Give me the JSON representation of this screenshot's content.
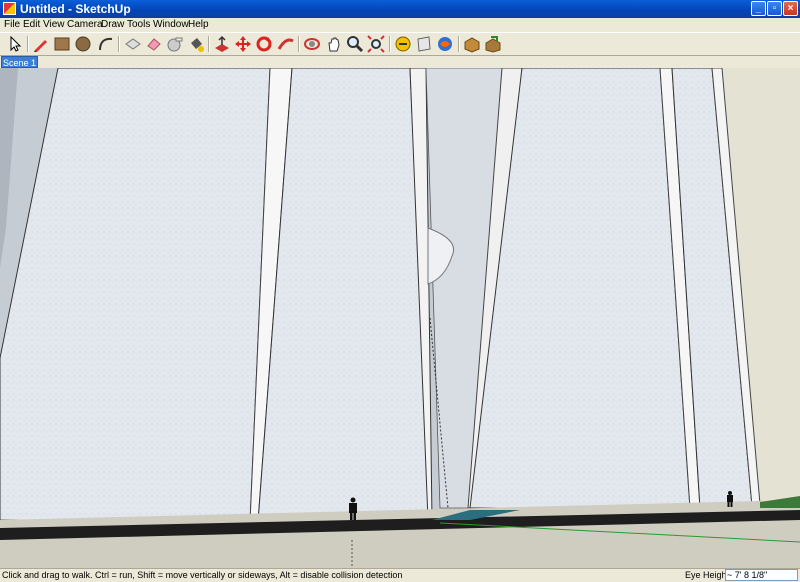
{
  "window": {
    "title": "Untitled - SketchUp"
  },
  "menu": [
    "File",
    "Edit",
    "View",
    "Camera",
    "Draw",
    "Tools",
    "Window",
    "Help"
  ],
  "toolbar": [
    "select-icon",
    "pencil-icon",
    "rectangle-icon",
    "circle-icon",
    "arc-icon",
    "make-component-icon",
    "eraser-icon",
    "tape-measure-icon",
    "paint-bucket-icon",
    "push-pull-icon",
    "move-icon",
    "rotate-icon",
    "follow-me-icon",
    "orbit-icon",
    "pan-icon",
    "zoom-icon",
    "zoom-extents-icon",
    "walk-icon",
    "section-plane-icon",
    "look-around-icon",
    "get-models-icon",
    "share-model-icon"
  ],
  "scene": {
    "tab_label": "Scene 1"
  },
  "statusbar": {
    "hint": "Click and drag to walk.  Ctrl = run, Shift = move vertically or sideways, Alt =  disable collision detection",
    "eye_height_label": "Eye Height",
    "eye_height_value": "~ 7' 8 1/8\""
  },
  "colors": {
    "titlebar": "#0445b8",
    "chrome": "#ece9d8",
    "wall": "#e3e7ee",
    "ground": "#cfccc0",
    "road": "#222222",
    "grass": "#3d7a3a"
  }
}
